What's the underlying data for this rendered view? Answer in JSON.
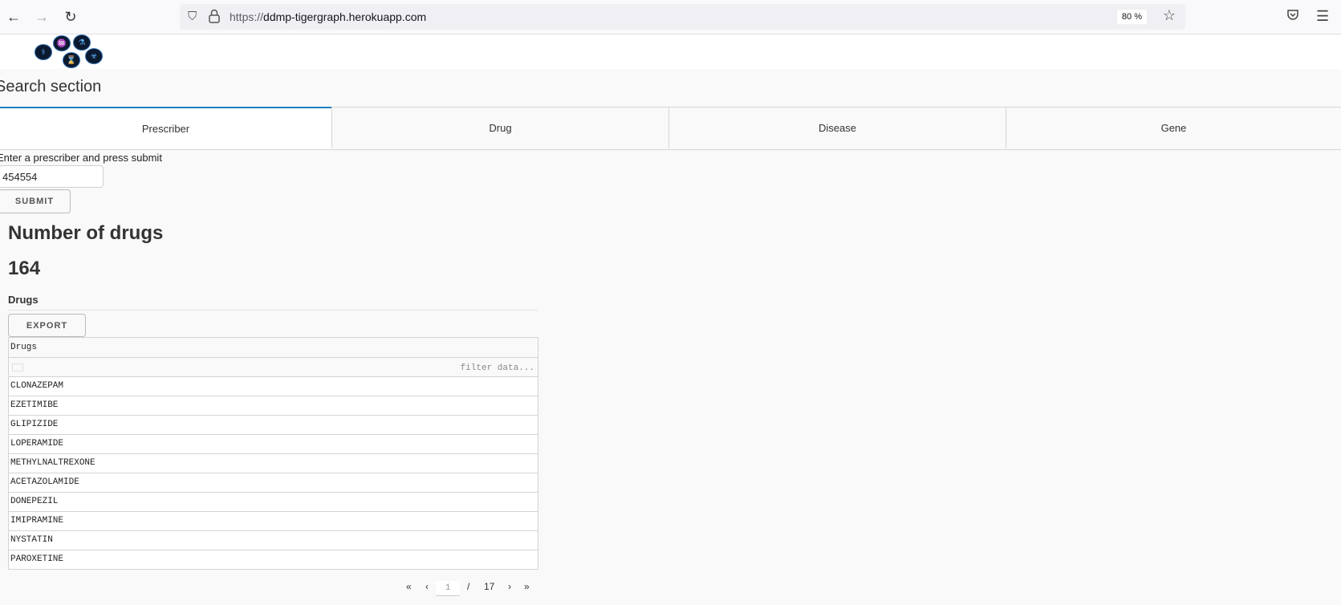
{
  "browser": {
    "url_scheme": "https://",
    "url_host": "ddmp-tigergraph.herokuapp.com",
    "zoom": "80 %"
  },
  "search": {
    "section_title": "Search section",
    "tabs": [
      {
        "label": "Prescriber",
        "active": true
      },
      {
        "label": "Drug",
        "active": false
      },
      {
        "label": "Disease",
        "active": false
      },
      {
        "label": "Gene",
        "active": false
      }
    ],
    "prompt": "Enter a prescriber and press submit",
    "input_value": "454554",
    "submit_label": "SUBMIT"
  },
  "results": {
    "count_title": "Number of drugs",
    "count_value": "164",
    "table_title": "Drugs",
    "export_label": "EXPORT",
    "column_header": "Drugs",
    "filter_placeholder": "filter data...",
    "rows": [
      "CLONAZEPAM",
      "EZETIMIBE",
      "GLIPIZIDE",
      "LOPERAMIDE",
      "METHYLNALTREXONE",
      "ACETAZOLAMIDE",
      "DONEPEZIL",
      "IMIPRAMINE",
      "NYSTATIN",
      "PAROXETINE"
    ]
  },
  "pagination": {
    "first": "«",
    "prev": "‹",
    "current_page": "1",
    "separator": "/",
    "total_pages": "17",
    "next": "›",
    "last": "»"
  },
  "colors": {
    "accent_tab": "#1f7fc1",
    "logo_bg": "#0b1a2e",
    "logo_fg": "#5fb2ff"
  }
}
